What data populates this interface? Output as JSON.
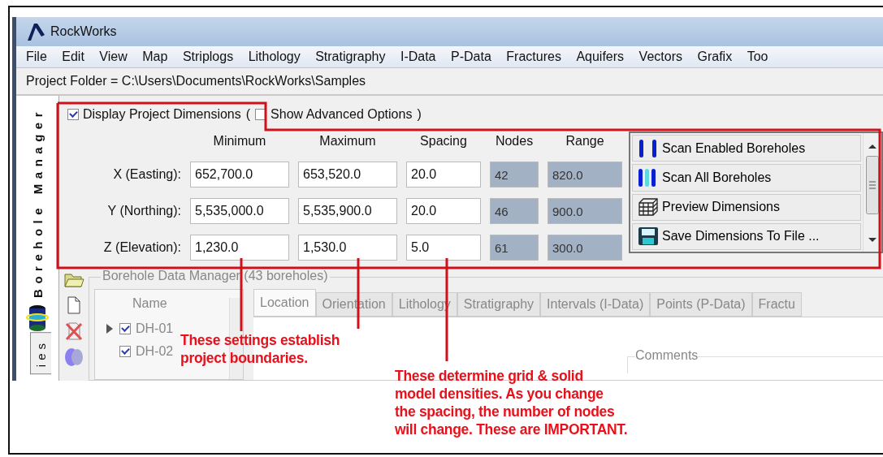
{
  "window": {
    "title": "RockWorks"
  },
  "menu": [
    "File",
    "Edit",
    "View",
    "Map",
    "Striplogs",
    "Lithology",
    "Stratigraphy",
    "I-Data",
    "P-Data",
    "Fractures",
    "Aquifers",
    "Vectors",
    "Grafix",
    "Too"
  ],
  "project_folder": "Project Folder = C:\\Users\\Documents\\RockWorks\\Samples",
  "side_tabs": [
    {
      "label": "Borehole Manager",
      "selected": true
    },
    {
      "label": "ies",
      "selected": false
    }
  ],
  "dimensions": {
    "display_checkbox": {
      "label": "Display Project Dimensions",
      "checked": true
    },
    "open_paren": "(",
    "advanced_checkbox": {
      "label": "Show Advanced Options",
      "checked": false
    },
    "close_paren": ")",
    "columns": [
      {
        "label": "Minimum",
        "readonly": false
      },
      {
        "label": "Maximum",
        "readonly": false
      },
      {
        "label": "Spacing",
        "readonly": false
      },
      {
        "label": "Nodes",
        "readonly": true
      },
      {
        "label": "Range",
        "readonly": true
      }
    ],
    "rows": [
      {
        "label": "X (Easting):",
        "values": [
          "652,700.0",
          "653,520.0",
          "20.0",
          "42",
          "820.0"
        ]
      },
      {
        "label": "Y (Northing):",
        "values": [
          "5,535,000.0",
          "5,535,900.0",
          "20.0",
          "46",
          "900.0"
        ]
      },
      {
        "label": "Z (Elevation):",
        "values": [
          "1,230.0",
          "1,530.0",
          "5.0",
          "61",
          "300.0"
        ]
      }
    ],
    "actions": [
      {
        "label": "Scan Enabled Boreholes"
      },
      {
        "label": "Scan All Boreholes"
      },
      {
        "label": "Preview Dimensions"
      },
      {
        "label": "Save Dimensions To File ..."
      }
    ]
  },
  "borehole_manager": {
    "title": "Borehole Data Manager (43 boreholes)",
    "name_header": "Name",
    "boreholes": [
      {
        "name": "DH-01",
        "checked": true
      },
      {
        "name": "DH-02",
        "checked": true
      }
    ],
    "tabs": [
      {
        "label": "Location",
        "selected": true
      },
      {
        "label": "Orientation",
        "selected": false
      },
      {
        "label": "Lithology",
        "selected": false
      },
      {
        "label": "Stratigraphy",
        "selected": false
      },
      {
        "label": "Intervals (I-Data)",
        "selected": false
      },
      {
        "label": "Points (P-Data)",
        "selected": false
      },
      {
        "label": "Fractu",
        "selected": false
      }
    ],
    "comments_label": "Comments"
  },
  "annotations": [
    {
      "lines": [
        "These settings establish",
        "project boundaries."
      ]
    },
    {
      "lines": [
        "These determine grid & solid",
        "model densities.  As you change",
        "the spacing, the number of nodes",
        "will change.  These are IMPORTANT."
      ]
    }
  ]
}
